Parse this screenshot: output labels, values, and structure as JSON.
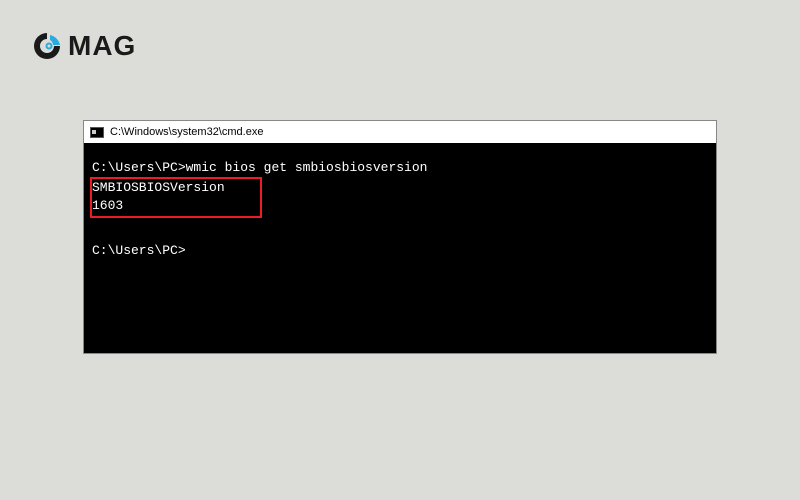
{
  "logo": {
    "text": "MAG"
  },
  "window": {
    "title": "C:\\Windows\\system32\\cmd.exe"
  },
  "terminal": {
    "prompt1": "C:\\Users\\PC>",
    "command": "wmic bios get smbiosbiosversion",
    "output_header": "SMBIOSBIOSVersion",
    "output_value": "1603",
    "prompt2": "C:\\Users\\PC>"
  }
}
